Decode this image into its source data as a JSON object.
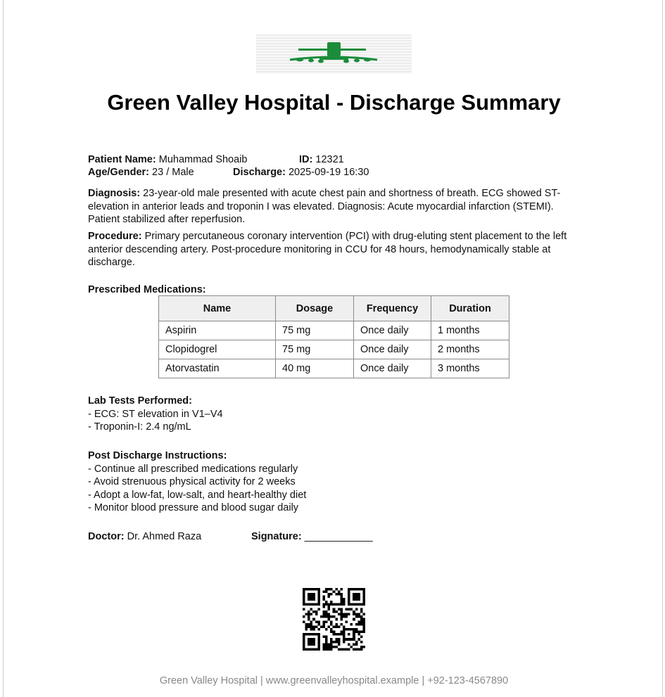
{
  "title": "Green Valley Hospital - Discharge Summary",
  "patient": {
    "name_label": "Patient Name:",
    "name": "Muhammad Shoaib",
    "id_label": "ID:",
    "id": "12321",
    "age_gender_label": "Age/Gender:",
    "age_gender": "23 / Male",
    "discharge_label": "Discharge:",
    "discharge": "2025-09-19 16:30"
  },
  "diagnosis": {
    "label": "Diagnosis:",
    "text": "23-year-old male presented with acute chest pain and shortness of breath. ECG showed ST-elevation in anterior leads and troponin I was elevated. Diagnosis: Acute myocardial infarction (STEMI). Patient stabilized after reperfusion."
  },
  "procedure": {
    "label": "Procedure:",
    "text": "Primary percutaneous coronary intervention (PCI) with drug-eluting stent placement to the left anterior descending artery. Post-procedure monitoring in CCU for 48 hours, hemodynamically stable at discharge."
  },
  "medications": {
    "heading": "Prescribed Medications:",
    "columns": [
      "Name",
      "Dosage",
      "Frequency",
      "Duration"
    ],
    "rows": [
      [
        "Aspirin",
        "75 mg",
        "Once daily",
        "1 months"
      ],
      [
        "Clopidogrel",
        "75 mg",
        "Once daily",
        "2 months"
      ],
      [
        "Atorvastatin",
        "40 mg",
        "Once daily",
        "3 months"
      ]
    ]
  },
  "labs": {
    "heading": "Lab Tests Performed:",
    "items": [
      "- ECG: ST elevation in V1–V4",
      "- Troponin-I: 2.4 ng/mL"
    ]
  },
  "instructions": {
    "heading": "Post Discharge Instructions:",
    "items": [
      "- Continue all prescribed medications regularly",
      "- Avoid strenuous physical activity for 2 weeks",
      "- Adopt a low-fat, low-salt, and heart-healthy diet",
      "- Monitor blood pressure and blood sugar daily"
    ]
  },
  "doctor": {
    "label": "Doctor:",
    "name": "Dr. Ahmed Raza",
    "signature_label": "Signature:",
    "signature_line": "____________"
  },
  "footer": "Green Valley Hospital | www.greenvalleyhospital.example | +92-123-4567890",
  "colors": {
    "brand_green": "#1a8c3a",
    "footer_gray": "#888888"
  },
  "icons": {
    "logo": "hospital-logo",
    "qr": "qr-code"
  }
}
